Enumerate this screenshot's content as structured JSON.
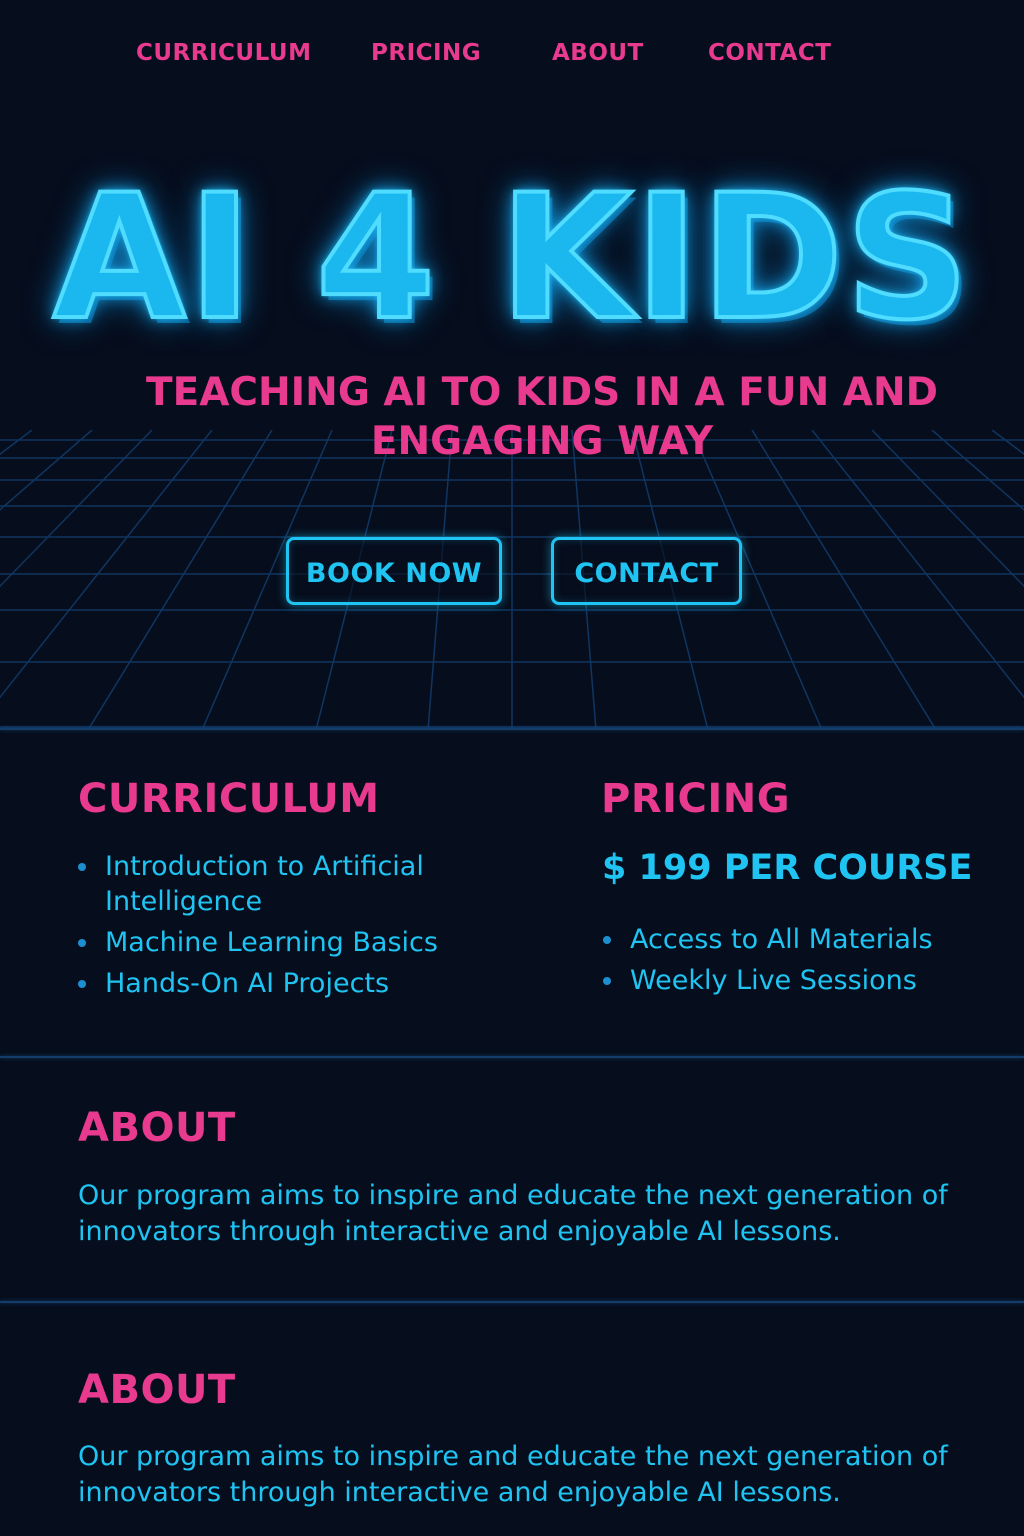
{
  "nav": {
    "items": [
      "CURRICULUM",
      "PRICING",
      "ABOUT",
      "CONTACT"
    ]
  },
  "hero": {
    "title": "AI 4 KIDS",
    "subtitle": "TEACHING AI TO KIDS IN A FUN AND ENGAGING WAY",
    "buttons": {
      "book": "BOOK NOW",
      "contact": "CONTACT"
    }
  },
  "curriculum": {
    "heading": "CURRICULUM",
    "items": [
      "Introduction to Artificial Intelligence",
      "Machine Learning Basics",
      "Hands-On AI Projects"
    ]
  },
  "pricing": {
    "heading": "PRICING",
    "price": "$ 199 PER COURSE",
    "items": [
      "Access to All Materials",
      "Weekly Live Sessions"
    ]
  },
  "about": [
    {
      "heading": "ABOUT",
      "text": "Our program aims to inspire and educate the next generation of innovators through interactive and enjoyable AI lessons."
    },
    {
      "heading": "ABOUT",
      "text": "Our program aims to inspire and educate the next generation of innovators through interactive and enjoyable AI lessons."
    }
  ],
  "colors": {
    "background": "#060d1c",
    "accent_pink": "#e83a8f",
    "accent_cyan": "#1fc4f2",
    "grid_line": "#143a6b"
  }
}
